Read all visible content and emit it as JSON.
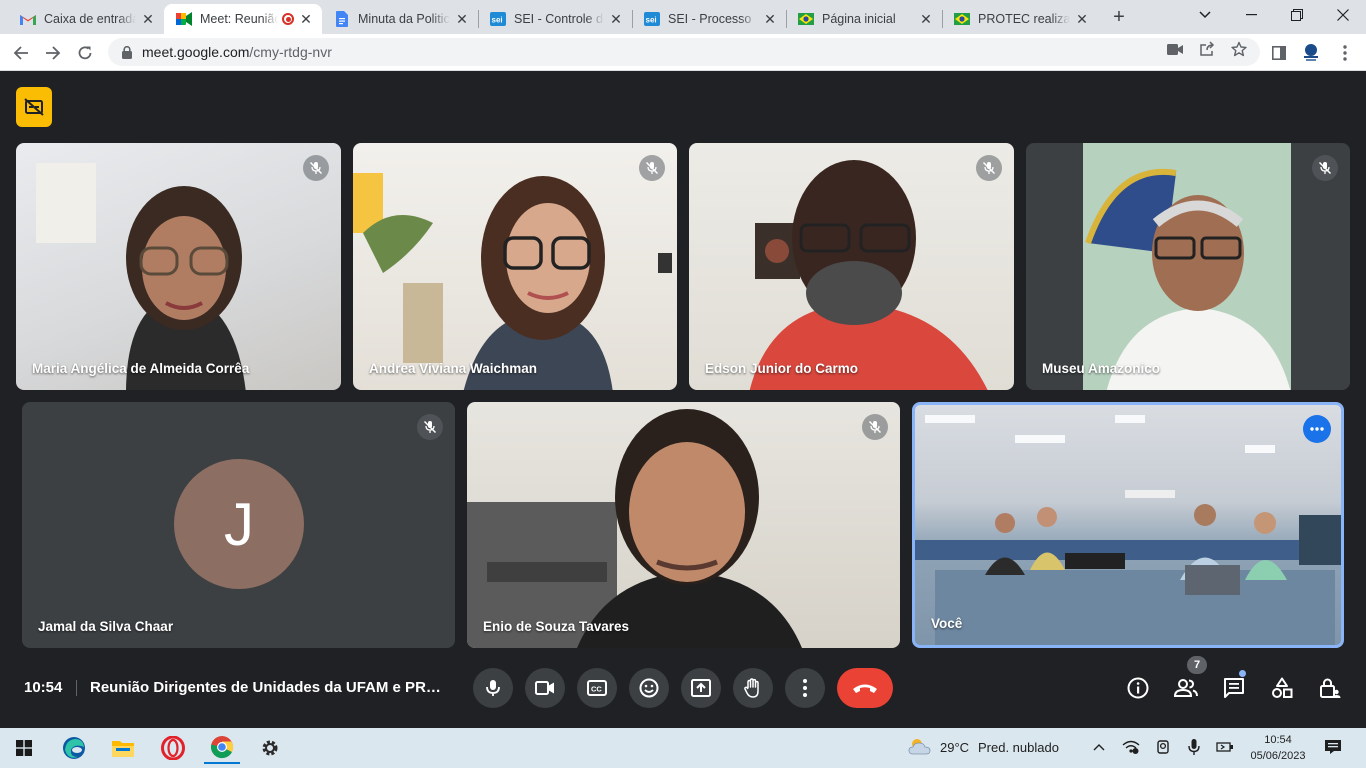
{
  "browser": {
    "tabs": [
      {
        "title": "Caixa de entrada",
        "icon": "gmail-icon"
      },
      {
        "title": "Meet: Reunião",
        "icon": "meet-icon",
        "active": true
      },
      {
        "title": "Minuta da Politica",
        "icon": "docs-icon"
      },
      {
        "title": "SEI - Controle de",
        "icon": "sei-icon"
      },
      {
        "title": "SEI - Processo",
        "icon": "sei-icon"
      },
      {
        "title": "Página inicial",
        "icon": "brazil-flag-icon"
      },
      {
        "title": "PROTEC realiza a",
        "icon": "brazil-flag-icon"
      }
    ],
    "url_host": "meet.google.com",
    "url_path": "/cmy-rtdg-nvr"
  },
  "meet": {
    "participants": [
      {
        "name": "Maria Angélica de Almeida Corrêa",
        "muted": true
      },
      {
        "name": "Andrea Viviana Waichman",
        "muted": true
      },
      {
        "name": "Edson Junior do Carmo",
        "muted": true
      },
      {
        "name": "Museu Amazonico",
        "muted": true
      },
      {
        "name": "Jamal da Silva Chaar",
        "muted": true,
        "avatar_letter": "J"
      },
      {
        "name": "Enio de Souza Tavares",
        "muted": true
      },
      {
        "name": "Você",
        "muted": false
      }
    ],
    "time": "10:54",
    "meeting_title": "Reunião Dirigentes de Unidades da UFAM e PROTEC",
    "people_count": "7",
    "colors": {
      "end_call": "#ea4335",
      "self_border": "#8ab4f8",
      "captions_badge": "#fbbc04"
    }
  },
  "taskbar": {
    "weather_temp": "29°C",
    "weather_desc": "Pred. nublado",
    "time": "10:54",
    "date": "05/06/2023",
    "apps": [
      "windows-start-icon",
      "edge-icon",
      "file-explorer-icon",
      "opera-icon",
      "chrome-icon",
      "settings-icon"
    ]
  }
}
